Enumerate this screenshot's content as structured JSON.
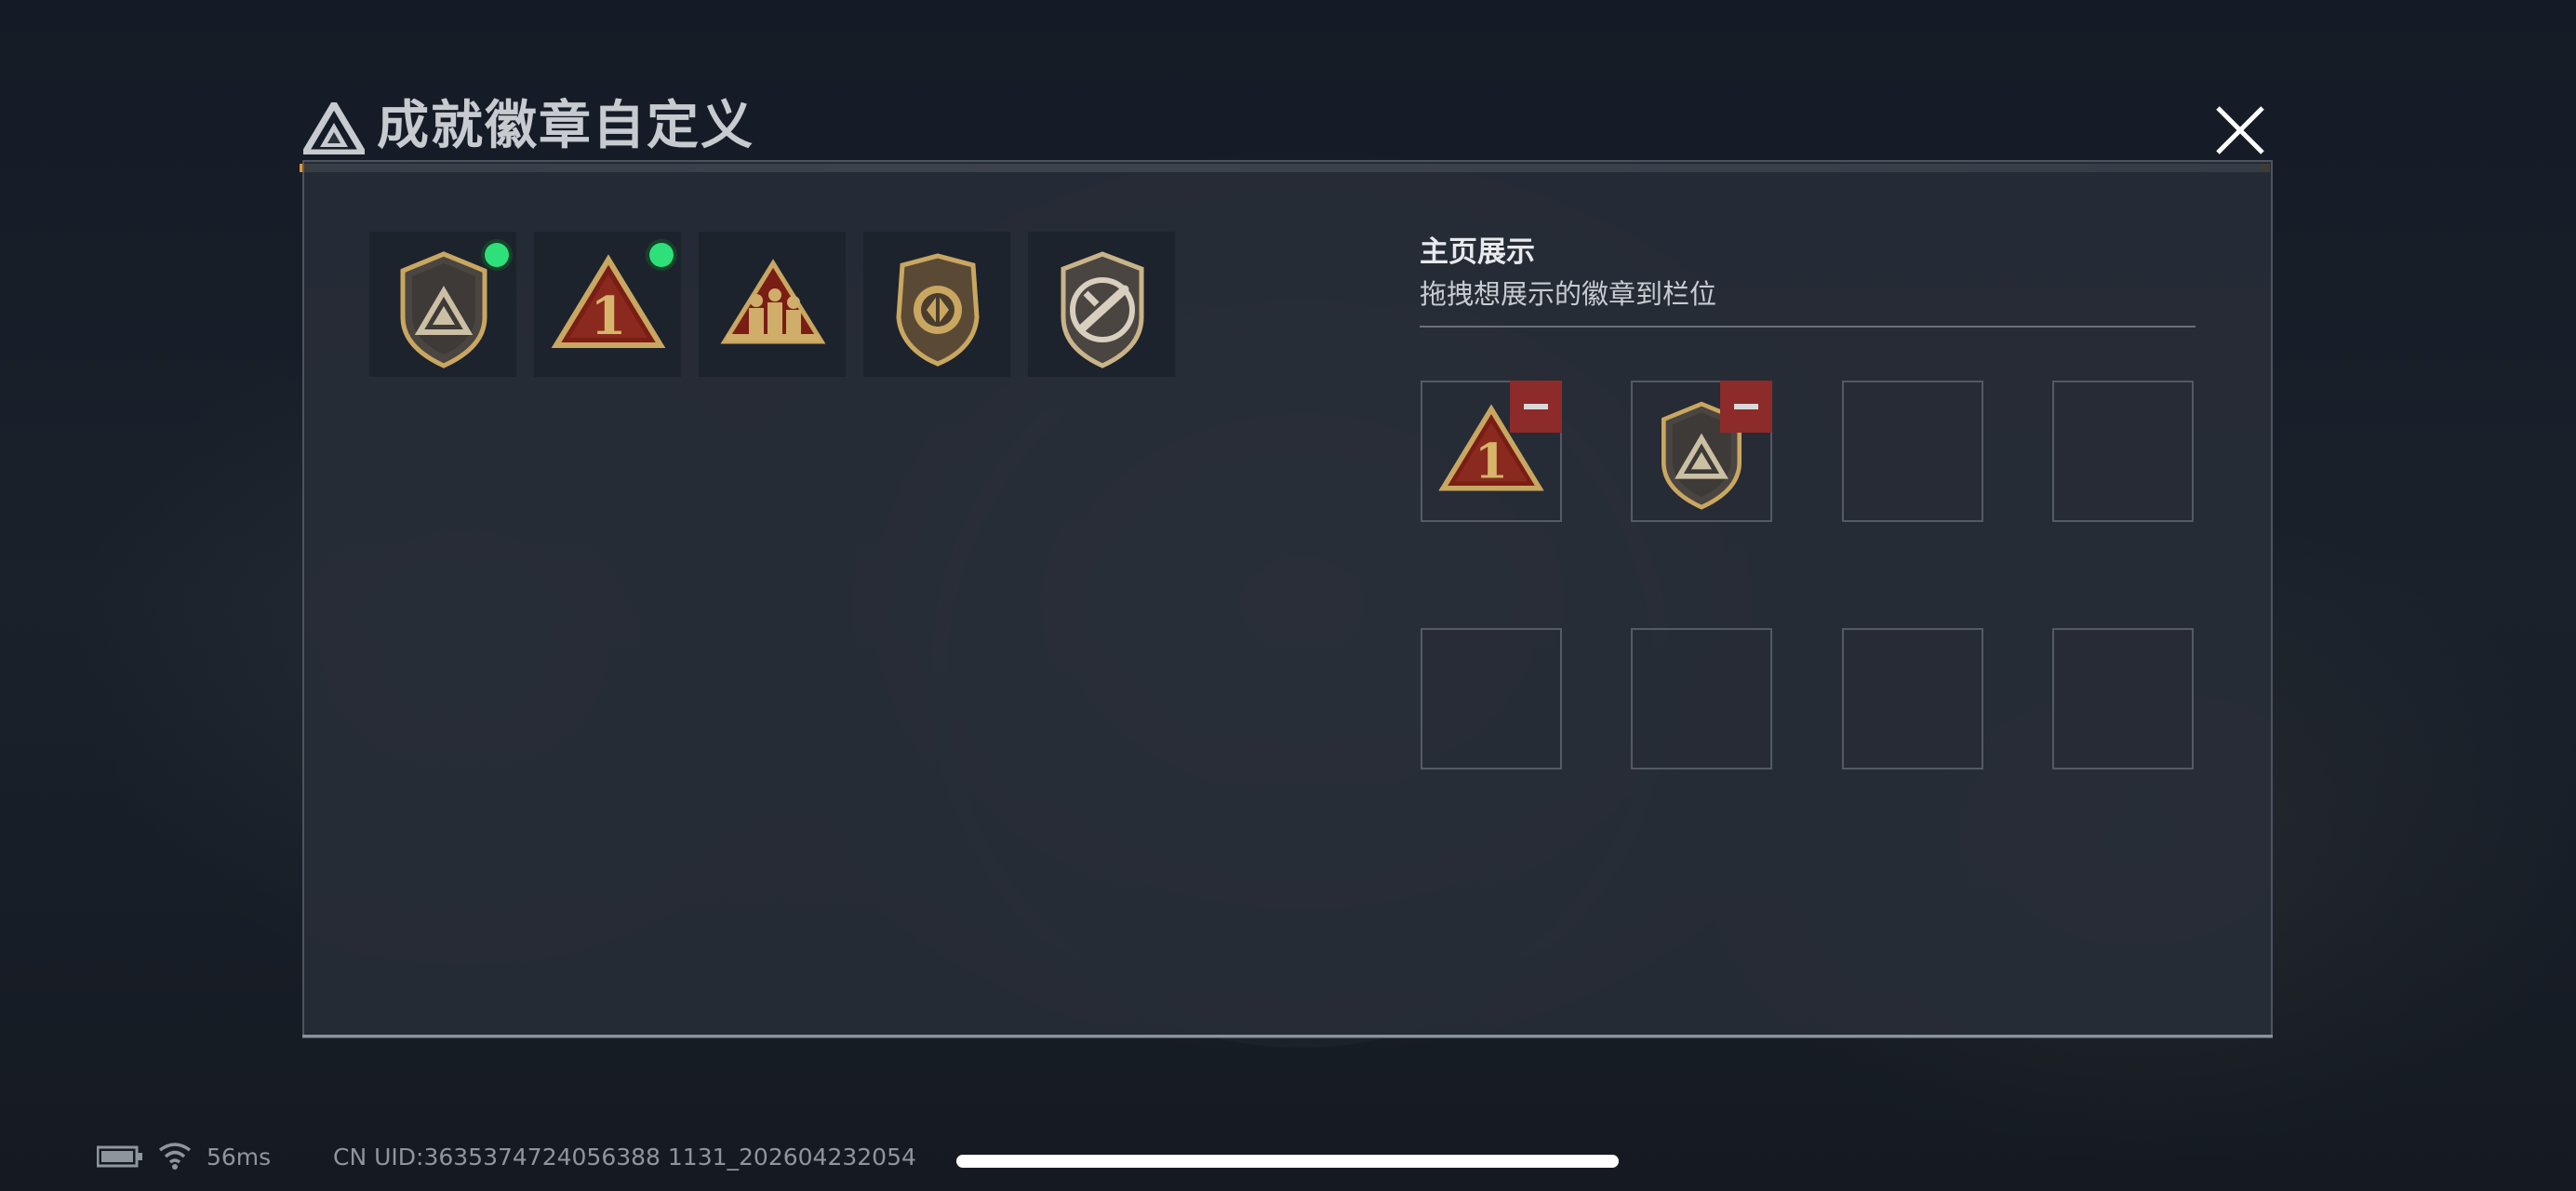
{
  "window": {
    "title": "成就徽章自定义",
    "close_icon": "close-x-icon",
    "logo_icon": "triangle-logo-icon"
  },
  "badge_collection": [
    {
      "name": "shield-triangle-badge",
      "icon": "shield-triangle-icon",
      "is_new": true
    },
    {
      "name": "number-one-badge",
      "icon": "triangle-number-one-icon",
      "is_new": true
    },
    {
      "name": "soldiers-badge",
      "icon": "triangle-soldiers-icon",
      "is_new": false
    },
    {
      "name": "shield-diamond-badge",
      "icon": "shield-diamond-icon",
      "is_new": false
    },
    {
      "name": "shield-knife-badge",
      "icon": "shield-knife-icon",
      "is_new": false
    }
  ],
  "showcase": {
    "title": "主页展示",
    "subtitle": "拖拽想展示的徽章到栏位",
    "slots": [
      {
        "badge": "triangle-number-one-icon",
        "removable": true
      },
      {
        "badge": "shield-triangle-icon",
        "removable": true
      },
      {
        "badge": null,
        "removable": false
      },
      {
        "badge": null,
        "removable": false
      },
      {
        "badge": null,
        "removable": false
      },
      {
        "badge": null,
        "removable": false
      },
      {
        "badge": null,
        "removable": false
      },
      {
        "badge": null,
        "removable": false
      }
    ],
    "remove_icon": "minus-icon"
  },
  "status_bar": {
    "battery_icon": "battery-icon",
    "wifi_icon": "wifi-icon",
    "ping": "56ms",
    "uid": "CN UID:3635374724056388 1131_202604232054"
  },
  "colors": {
    "new_dot": "#2ee07a",
    "remove_button": "#8d2a2a",
    "badge_gold": "#c9a761",
    "badge_red": "#8a1f17"
  }
}
